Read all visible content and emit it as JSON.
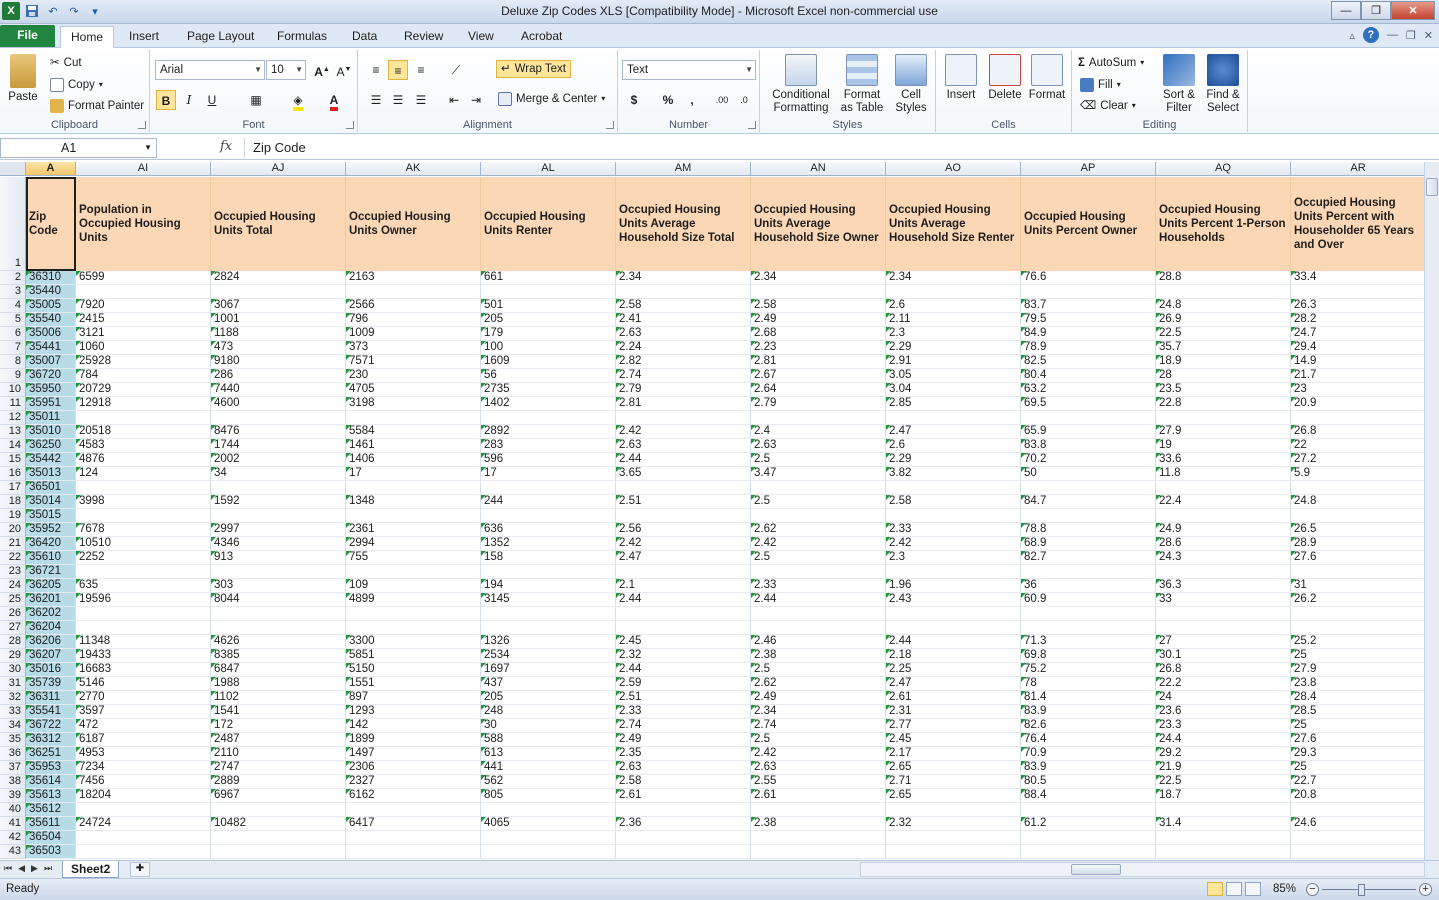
{
  "window": {
    "title": "Deluxe Zip Codes XLS  [Compatibility Mode]  -  Microsoft Excel non-commercial use",
    "app_icon": "X"
  },
  "ribbon_tabs": [
    "File",
    "Home",
    "Insert",
    "Page Layout",
    "Formulas",
    "Data",
    "Review",
    "View",
    "Acrobat"
  ],
  "active_tab": "Home",
  "ribbon": {
    "clipboard": {
      "group": "Clipboard",
      "paste": "Paste",
      "cut": "Cut",
      "copy": "Copy",
      "format_painter": "Format Painter"
    },
    "font": {
      "group": "Font",
      "name": "Arial",
      "size": "10",
      "bold": "B",
      "italic": "I",
      "underline": "U"
    },
    "alignment": {
      "group": "Alignment",
      "wrap_text": "Wrap Text",
      "merge_center": "Merge & Center"
    },
    "number": {
      "group": "Number",
      "format": "Text",
      "currency": "$",
      "percent": "%",
      "comma": ","
    },
    "styles": {
      "group": "Styles",
      "conditional": "Conditional Formatting",
      "format_table": "Format as Table",
      "cell_styles": "Cell Styles"
    },
    "cells": {
      "group": "Cells",
      "insert": "Insert",
      "delete": "Delete",
      "format": "Format"
    },
    "editing": {
      "group": "Editing",
      "autosum": "AutoSum",
      "fill": "Fill",
      "clear": "Clear",
      "sort_filter": "Sort & Filter",
      "find_select": "Find & Select"
    }
  },
  "formula_bar": {
    "name_box": "A1",
    "fx": "fx",
    "content": "Zip Code"
  },
  "columns": [
    {
      "letter": "A",
      "header": "Zip Code"
    },
    {
      "letter": "AI",
      "header": "Population in Occupied Housing Units"
    },
    {
      "letter": "AJ",
      "header": "Occupied Housing Units Total"
    },
    {
      "letter": "AK",
      "header": "Occupied Housing Units Owner"
    },
    {
      "letter": "AL",
      "header": "Occupied Housing Units Renter"
    },
    {
      "letter": "AM",
      "header": "Occupied Housing Units Average Household Size Total"
    },
    {
      "letter": "AN",
      "header": "Occupied Housing Units Average Household Size Owner"
    },
    {
      "letter": "AO",
      "header": "Occupied Housing Units Average Household Size Renter"
    },
    {
      "letter": "AP",
      "header": "Occupied Housing Units Percent Owner"
    },
    {
      "letter": "AQ",
      "header": "Occupied Housing Units Percent 1-Person Households"
    },
    {
      "letter": "AR",
      "header": "Occupied Housing Units Percent with Householder 65 Years and Over"
    }
  ],
  "rows": [
    {
      "n": "2",
      "v": [
        "36310",
        "6599",
        "2824",
        "2163",
        "661",
        "2.34",
        "2.34",
        "2.34",
        "76.6",
        "28.8",
        "33.4"
      ]
    },
    {
      "n": "3",
      "v": [
        "35440",
        "",
        "",
        "",
        "",
        "",
        "",
        "",
        "",
        "",
        ""
      ]
    },
    {
      "n": "4",
      "v": [
        "35005",
        "7920",
        "3067",
        "2566",
        "501",
        "2.58",
        "2.58",
        "2.6",
        "83.7",
        "24.8",
        "26.3"
      ]
    },
    {
      "n": "5",
      "v": [
        "35540",
        "2415",
        "1001",
        "796",
        "205",
        "2.41",
        "2.49",
        "2.11",
        "79.5",
        "26.9",
        "28.2"
      ]
    },
    {
      "n": "6",
      "v": [
        "35006",
        "3121",
        "1188",
        "1009",
        "179",
        "2.63",
        "2.68",
        "2.3",
        "84.9",
        "22.5",
        "24.7"
      ]
    },
    {
      "n": "7",
      "v": [
        "35441",
        "1060",
        "473",
        "373",
        "100",
        "2.24",
        "2.23",
        "2.29",
        "78.9",
        "35.7",
        "29.4"
      ]
    },
    {
      "n": "8",
      "v": [
        "35007",
        "25928",
        "9180",
        "7571",
        "1609",
        "2.82",
        "2.81",
        "2.91",
        "82.5",
        "18.9",
        "14.9"
      ]
    },
    {
      "n": "9",
      "v": [
        "36720",
        "784",
        "286",
        "230",
        "56",
        "2.74",
        "2.67",
        "3.05",
        "80.4",
        "28",
        "21.7"
      ]
    },
    {
      "n": "10",
      "v": [
        "35950",
        "20729",
        "7440",
        "4705",
        "2735",
        "2.79",
        "2.64",
        "3.04",
        "63.2",
        "23.5",
        "23"
      ]
    },
    {
      "n": "11",
      "v": [
        "35951",
        "12918",
        "4600",
        "3198",
        "1402",
        "2.81",
        "2.79",
        "2.85",
        "69.5",
        "22.8",
        "20.9"
      ]
    },
    {
      "n": "12",
      "v": [
        "35011",
        "",
        "",
        "",
        "",
        "",
        "",
        "",
        "",
        "",
        ""
      ]
    },
    {
      "n": "13",
      "v": [
        "35010",
        "20518",
        "8476",
        "5584",
        "2892",
        "2.42",
        "2.4",
        "2.47",
        "65.9",
        "27.9",
        "26.8"
      ]
    },
    {
      "n": "14",
      "v": [
        "36250",
        "4583",
        "1744",
        "1461",
        "283",
        "2.63",
        "2.63",
        "2.6",
        "83.8",
        "19",
        "22"
      ]
    },
    {
      "n": "15",
      "v": [
        "35442",
        "4876",
        "2002",
        "1406",
        "596",
        "2.44",
        "2.5",
        "2.29",
        "70.2",
        "33.6",
        "27.2"
      ]
    },
    {
      "n": "16",
      "v": [
        "35013",
        "124",
        "34",
        "17",
        "17",
        "3.65",
        "3.47",
        "3.82",
        "50",
        "11.8",
        "5.9"
      ]
    },
    {
      "n": "17",
      "v": [
        "36501",
        "",
        "",
        "",
        "",
        "",
        "",
        "",
        "",
        "",
        ""
      ]
    },
    {
      "n": "18",
      "v": [
        "35014",
        "3998",
        "1592",
        "1348",
        "244",
        "2.51",
        "2.5",
        "2.58",
        "84.7",
        "22.4",
        "24.8"
      ]
    },
    {
      "n": "19",
      "v": [
        "35015",
        "",
        "",
        "",
        "",
        "",
        "",
        "",
        "",
        "",
        ""
      ]
    },
    {
      "n": "20",
      "v": [
        "35952",
        "7678",
        "2997",
        "2361",
        "636",
        "2.56",
        "2.62",
        "2.33",
        "78.8",
        "24.9",
        "26.5"
      ]
    },
    {
      "n": "21",
      "v": [
        "36420",
        "10510",
        "4346",
        "2994",
        "1352",
        "2.42",
        "2.42",
        "2.42",
        "68.9",
        "28.6",
        "28.9"
      ]
    },
    {
      "n": "22",
      "v": [
        "35610",
        "2252",
        "913",
        "755",
        "158",
        "2.47",
        "2.5",
        "2.3",
        "82.7",
        "24.3",
        "27.6"
      ]
    },
    {
      "n": "23",
      "v": [
        "36721",
        "",
        "",
        "",
        "",
        "",
        "",
        "",
        "",
        "",
        ""
      ]
    },
    {
      "n": "24",
      "v": [
        "36205",
        "635",
        "303",
        "109",
        "194",
        "2.1",
        "2.33",
        "1.96",
        "36",
        "36.3",
        "31"
      ]
    },
    {
      "n": "25",
      "v": [
        "36201",
        "19596",
        "8044",
        "4899",
        "3145",
        "2.44",
        "2.44",
        "2.43",
        "60.9",
        "33",
        "26.2"
      ]
    },
    {
      "n": "26",
      "v": [
        "36202",
        "",
        "",
        "",
        "",
        "",
        "",
        "",
        "",
        "",
        ""
      ]
    },
    {
      "n": "27",
      "v": [
        "36204",
        "",
        "",
        "",
        "",
        "",
        "",
        "",
        "",
        "",
        ""
      ]
    },
    {
      "n": "28",
      "v": [
        "36206",
        "11348",
        "4626",
        "3300",
        "1326",
        "2.45",
        "2.46",
        "2.44",
        "71.3",
        "27",
        "25.2"
      ]
    },
    {
      "n": "29",
      "v": [
        "36207",
        "19433",
        "8385",
        "5851",
        "2534",
        "2.32",
        "2.38",
        "2.18",
        "69.8",
        "30.1",
        "25"
      ]
    },
    {
      "n": "30",
      "v": [
        "35016",
        "16683",
        "6847",
        "5150",
        "1697",
        "2.44",
        "2.5",
        "2.25",
        "75.2",
        "26.8",
        "27.9"
      ]
    },
    {
      "n": "31",
      "v": [
        "35739",
        "5146",
        "1988",
        "1551",
        "437",
        "2.59",
        "2.62",
        "2.47",
        "78",
        "22.2",
        "23.8"
      ]
    },
    {
      "n": "32",
      "v": [
        "36311",
        "2770",
        "1102",
        "897",
        "205",
        "2.51",
        "2.49",
        "2.61",
        "81.4",
        "24",
        "28.4"
      ]
    },
    {
      "n": "33",
      "v": [
        "35541",
        "3597",
        "1541",
        "1293",
        "248",
        "2.33",
        "2.34",
        "2.31",
        "83.9",
        "23.6",
        "28.5"
      ]
    },
    {
      "n": "34",
      "v": [
        "36722",
        "472",
        "172",
        "142",
        "30",
        "2.74",
        "2.74",
        "2.77",
        "82.6",
        "23.3",
        "25"
      ]
    },
    {
      "n": "35",
      "v": [
        "36312",
        "6187",
        "2487",
        "1899",
        "588",
        "2.49",
        "2.5",
        "2.45",
        "76.4",
        "24.4",
        "27.6"
      ]
    },
    {
      "n": "36",
      "v": [
        "36251",
        "4953",
        "2110",
        "1497",
        "613",
        "2.35",
        "2.42",
        "2.17",
        "70.9",
        "29.2",
        "29.3"
      ]
    },
    {
      "n": "37",
      "v": [
        "35953",
        "7234",
        "2747",
        "2306",
        "441",
        "2.63",
        "2.63",
        "2.65",
        "83.9",
        "21.9",
        "25"
      ]
    },
    {
      "n": "38",
      "v": [
        "35614",
        "7456",
        "2889",
        "2327",
        "562",
        "2.58",
        "2.55",
        "2.71",
        "80.5",
        "22.5",
        "22.7"
      ]
    },
    {
      "n": "39",
      "v": [
        "35613",
        "18204",
        "6967",
        "6162",
        "805",
        "2.61",
        "2.61",
        "2.65",
        "88.4",
        "18.7",
        "20.8"
      ]
    },
    {
      "n": "40",
      "v": [
        "35612",
        "",
        "",
        "",
        "",
        "",
        "",
        "",
        "",
        "",
        ""
      ]
    },
    {
      "n": "41",
      "v": [
        "35611",
        "24724",
        "10482",
        "6417",
        "4065",
        "2.36",
        "2.38",
        "2.32",
        "61.2",
        "31.4",
        "24.6"
      ]
    },
    {
      "n": "42",
      "v": [
        "36504",
        "",
        "",
        "",
        "",
        "",
        "",
        "",
        "",
        "",
        ""
      ]
    },
    {
      "n": "43",
      "v": [
        "36503",
        "",
        "",
        "",
        "",
        "",
        "",
        "",
        "",
        "",
        ""
      ]
    }
  ],
  "sheet_tabs": [
    "Sheet2"
  ],
  "status": {
    "ready": "Ready",
    "zoom": "85%"
  },
  "colors": {
    "header_fill": "#fbd7b5",
    "zip_column_fill": "#b7dce8",
    "file_tab": "#21853f"
  }
}
